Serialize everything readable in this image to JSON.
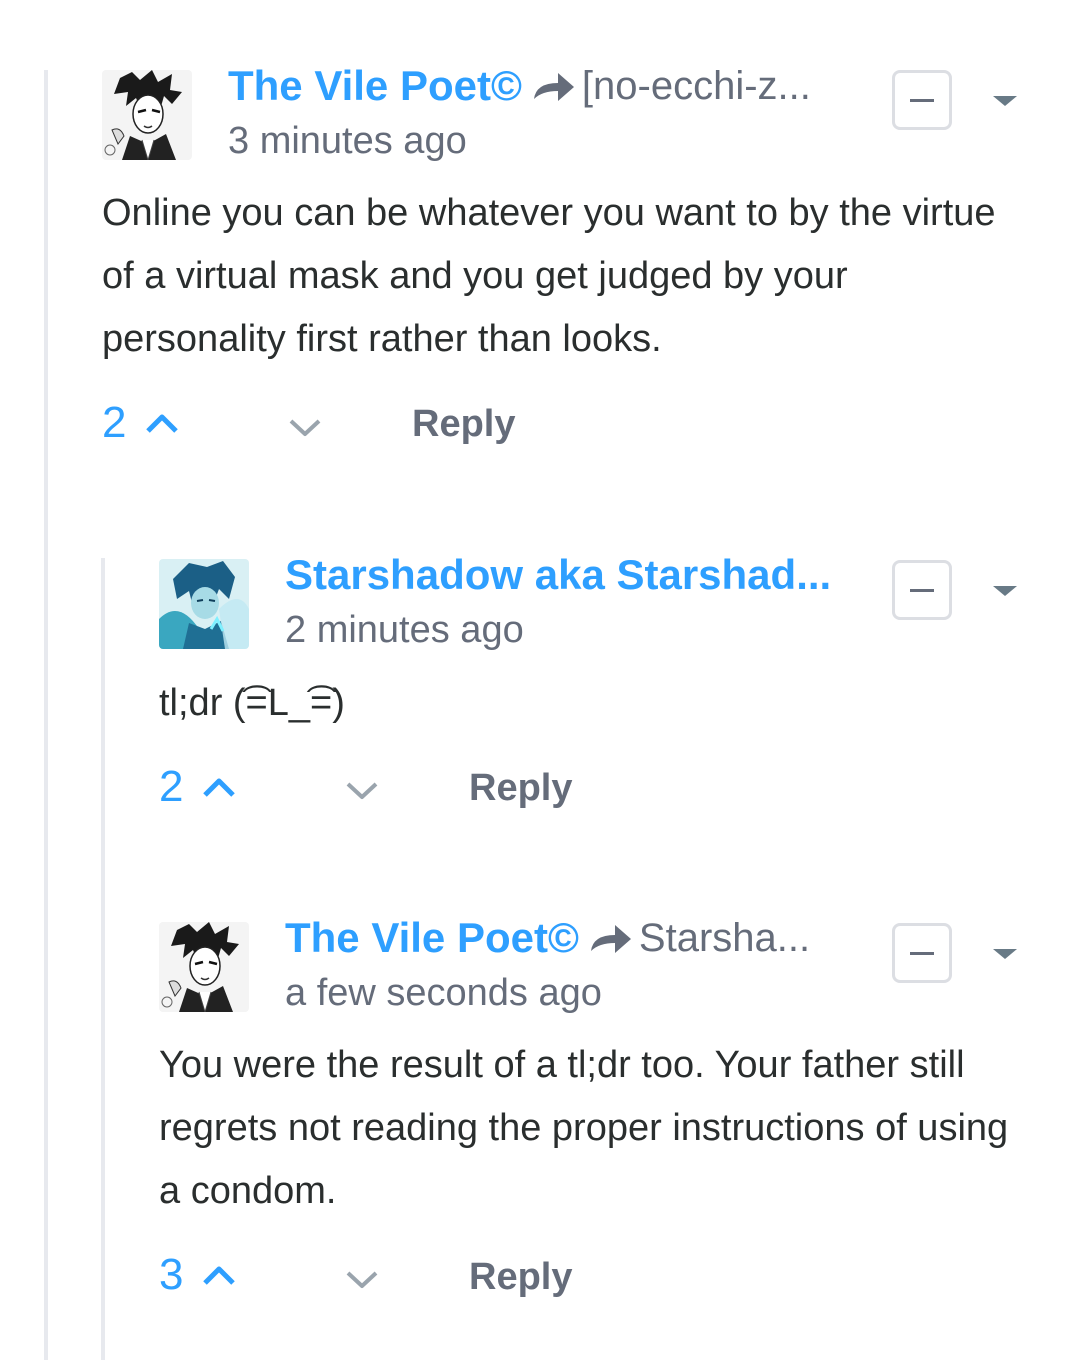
{
  "comments": [
    {
      "author": "The Vile Poet©",
      "reply_to": "[no-ecchi-z...",
      "time": "3 minutes ago",
      "body": "Online you can be whatever you want to by the virtue of a virtual mask and you get judged by your personality first rather than looks.",
      "votes": "2",
      "reply_label": "Reply",
      "avatar_icon": "avatar-manga-man-icon"
    },
    {
      "author": "Starshadow aka Starshad...",
      "reply_to": "",
      "time": "2 minutes ago",
      "body": "tl;dr (͡=L_͡=)",
      "votes": "2",
      "reply_label": "Reply",
      "avatar_icon": "avatar-blue-anime-icon"
    },
    {
      "author": "The Vile Poet©",
      "reply_to": "Starsha...",
      "time": "a few seconds ago",
      "body": "You were the result of a tl;dr too. Your father still regrets not reading the proper instructions of using a condom.",
      "votes": "3",
      "reply_label": "Reply",
      "avatar_icon": "avatar-manga-man-icon"
    }
  ],
  "colors": {
    "author": "#2e9fff",
    "muted": "#656c7a",
    "text": "#2a2e2e",
    "thread_line": "#e7e9ee"
  }
}
